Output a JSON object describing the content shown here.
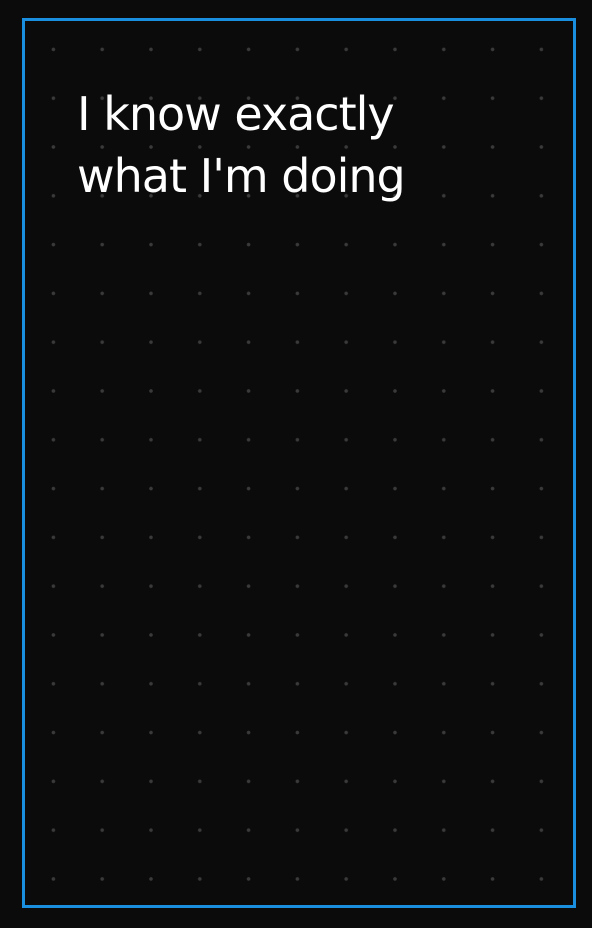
{
  "card": {
    "headline_line1": "I know exactly",
    "headline_line2": "what I'm doing"
  },
  "colors": {
    "background": "#0b0b0b",
    "border": "#1a8fe0",
    "dot": "#3a3a3a",
    "text": "#ffffff"
  }
}
